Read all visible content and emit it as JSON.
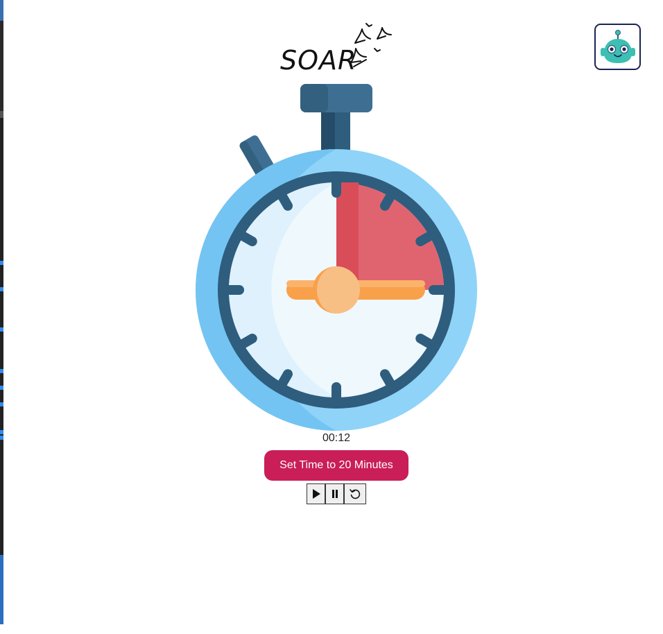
{
  "app": {
    "logo_text": "SOAR"
  },
  "timer": {
    "display": "00:12",
    "progress_fraction": 0.25
  },
  "actions": {
    "set_time_label": "Set Time to 20 Minutes"
  },
  "controls": [
    {
      "icon": "play-icon"
    },
    {
      "icon": "pause-icon"
    },
    {
      "icon": "reset-icon"
    }
  ],
  "colors": {
    "accent_button": "#c91e58",
    "watch_outer": "#8fd3f8",
    "watch_ring": "#2f5d7e",
    "watch_face": "#eef8fd",
    "sector": "#e0606c",
    "hand": "#f9a04a",
    "bot_frame": "#1a2352",
    "bot_body": "#3dbfb3"
  }
}
